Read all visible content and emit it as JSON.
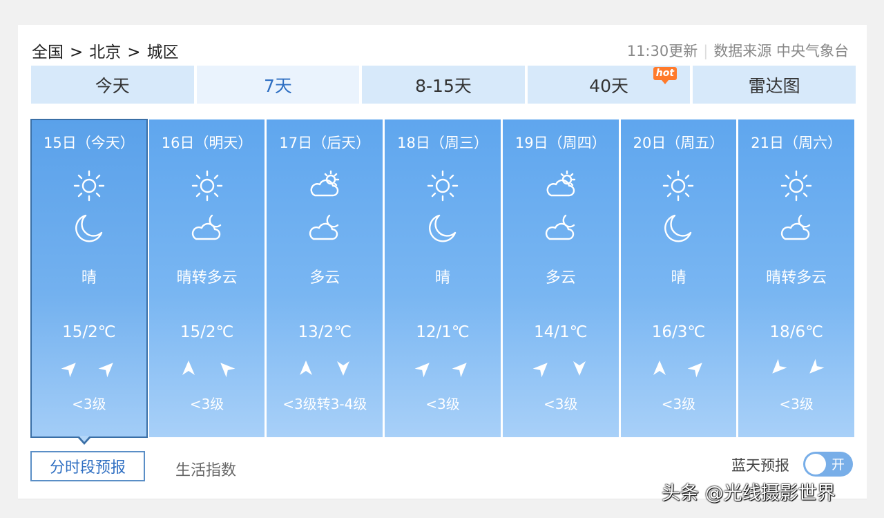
{
  "breadcrumb": {
    "level1": "全国",
    "level2": "北京",
    "level3": "城区",
    "separator": ">"
  },
  "update": {
    "time": "11:30更新",
    "source": "数据来源 中央气象台"
  },
  "tabs": [
    {
      "label": "今天"
    },
    {
      "label": "7天",
      "active": true
    },
    {
      "label": "8-15天"
    },
    {
      "label": "40天",
      "badge": "hot"
    },
    {
      "label": "雷达图"
    }
  ],
  "days": [
    {
      "date": "15日（今天）",
      "day_icon": "sun-icon",
      "night_icon": "moon-icon",
      "desc": "晴",
      "temp": "15/2℃",
      "wind_icons": [
        "wind-arrow-ne",
        "wind-arrow-ne"
      ],
      "wind_level": "<3级",
      "active": true
    },
    {
      "date": "16日（明天）",
      "day_icon": "sun-icon",
      "night_icon": "partly-cloudy-night-icon",
      "desc": "晴转多云",
      "temp": "15/2℃",
      "wind_icons": [
        "wind-arrow-n",
        "wind-arrow-nw"
      ],
      "wind_level": "<3级"
    },
    {
      "date": "17日（后天）",
      "day_icon": "partly-cloudy-day-icon",
      "night_icon": "partly-cloudy-night-icon",
      "desc": "多云",
      "temp": "13/2℃",
      "wind_icons": [
        "wind-arrow-n",
        "wind-arrow-s"
      ],
      "wind_level": "<3级转3-4级"
    },
    {
      "date": "18日（周三）",
      "day_icon": "sun-icon",
      "night_icon": "moon-icon",
      "desc": "晴",
      "temp": "12/1℃",
      "wind_icons": [
        "wind-arrow-ne",
        "wind-arrow-ne"
      ],
      "wind_level": "<3级"
    },
    {
      "date": "19日（周四）",
      "day_icon": "partly-cloudy-day-icon",
      "night_icon": "partly-cloudy-night-icon",
      "desc": "多云",
      "temp": "14/1℃",
      "wind_icons": [
        "wind-arrow-ne",
        "wind-arrow-s"
      ],
      "wind_level": "<3级"
    },
    {
      "date": "20日（周五）",
      "day_icon": "sun-icon",
      "night_icon": "moon-icon",
      "desc": "晴",
      "temp": "16/3℃",
      "wind_icons": [
        "wind-arrow-n",
        "wind-arrow-ne"
      ],
      "wind_level": "<3级"
    },
    {
      "date": "21日（周六）",
      "day_icon": "sun-icon",
      "night_icon": "partly-cloudy-night-icon",
      "desc": "晴转多云",
      "temp": "18/6℃",
      "wind_icons": [
        "wind-arrow-sw",
        "wind-arrow-sw"
      ],
      "wind_level": "<3级"
    }
  ],
  "bottom": {
    "period_button": "分时段预报",
    "life_index": "生活指数",
    "blue_sky_label": "蓝天预报",
    "toggle_label": "开"
  },
  "watermark": "头条 @光线摄影世界",
  "colors": {
    "card_top": "#5fa6ee",
    "card_bottom": "#a8d0f8",
    "tab_bg": "#d7e9fa",
    "accent": "#2f6fc2",
    "hot_badge": "#ff7a2b",
    "toggle_bg": "#78aee8"
  }
}
